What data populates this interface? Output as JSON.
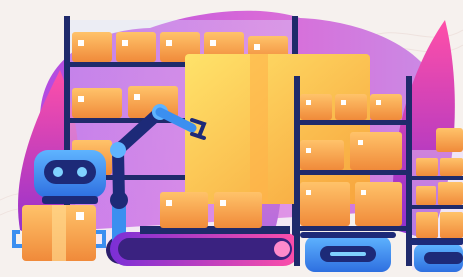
{
  "scene": {
    "palette": {
      "background": "#f6f1ee",
      "purple": "#9b3dd6",
      "magenta": "#d43cc0",
      "pink": "#ff4fa8",
      "box": "#f4a545",
      "box_light": "#ffc56a",
      "robot_blue": "#3b8ff0",
      "robot_dark": "#1d2a78",
      "conveyor": "#2c1f6b",
      "shelf": "#1f2a6b"
    },
    "icons": [
      "warehouse-shelf-icon",
      "cardboard-box-icon",
      "robotic-arm-icon",
      "delivery-robot-icon",
      "conveyor-belt-icon",
      "leaf-icon"
    ]
  }
}
